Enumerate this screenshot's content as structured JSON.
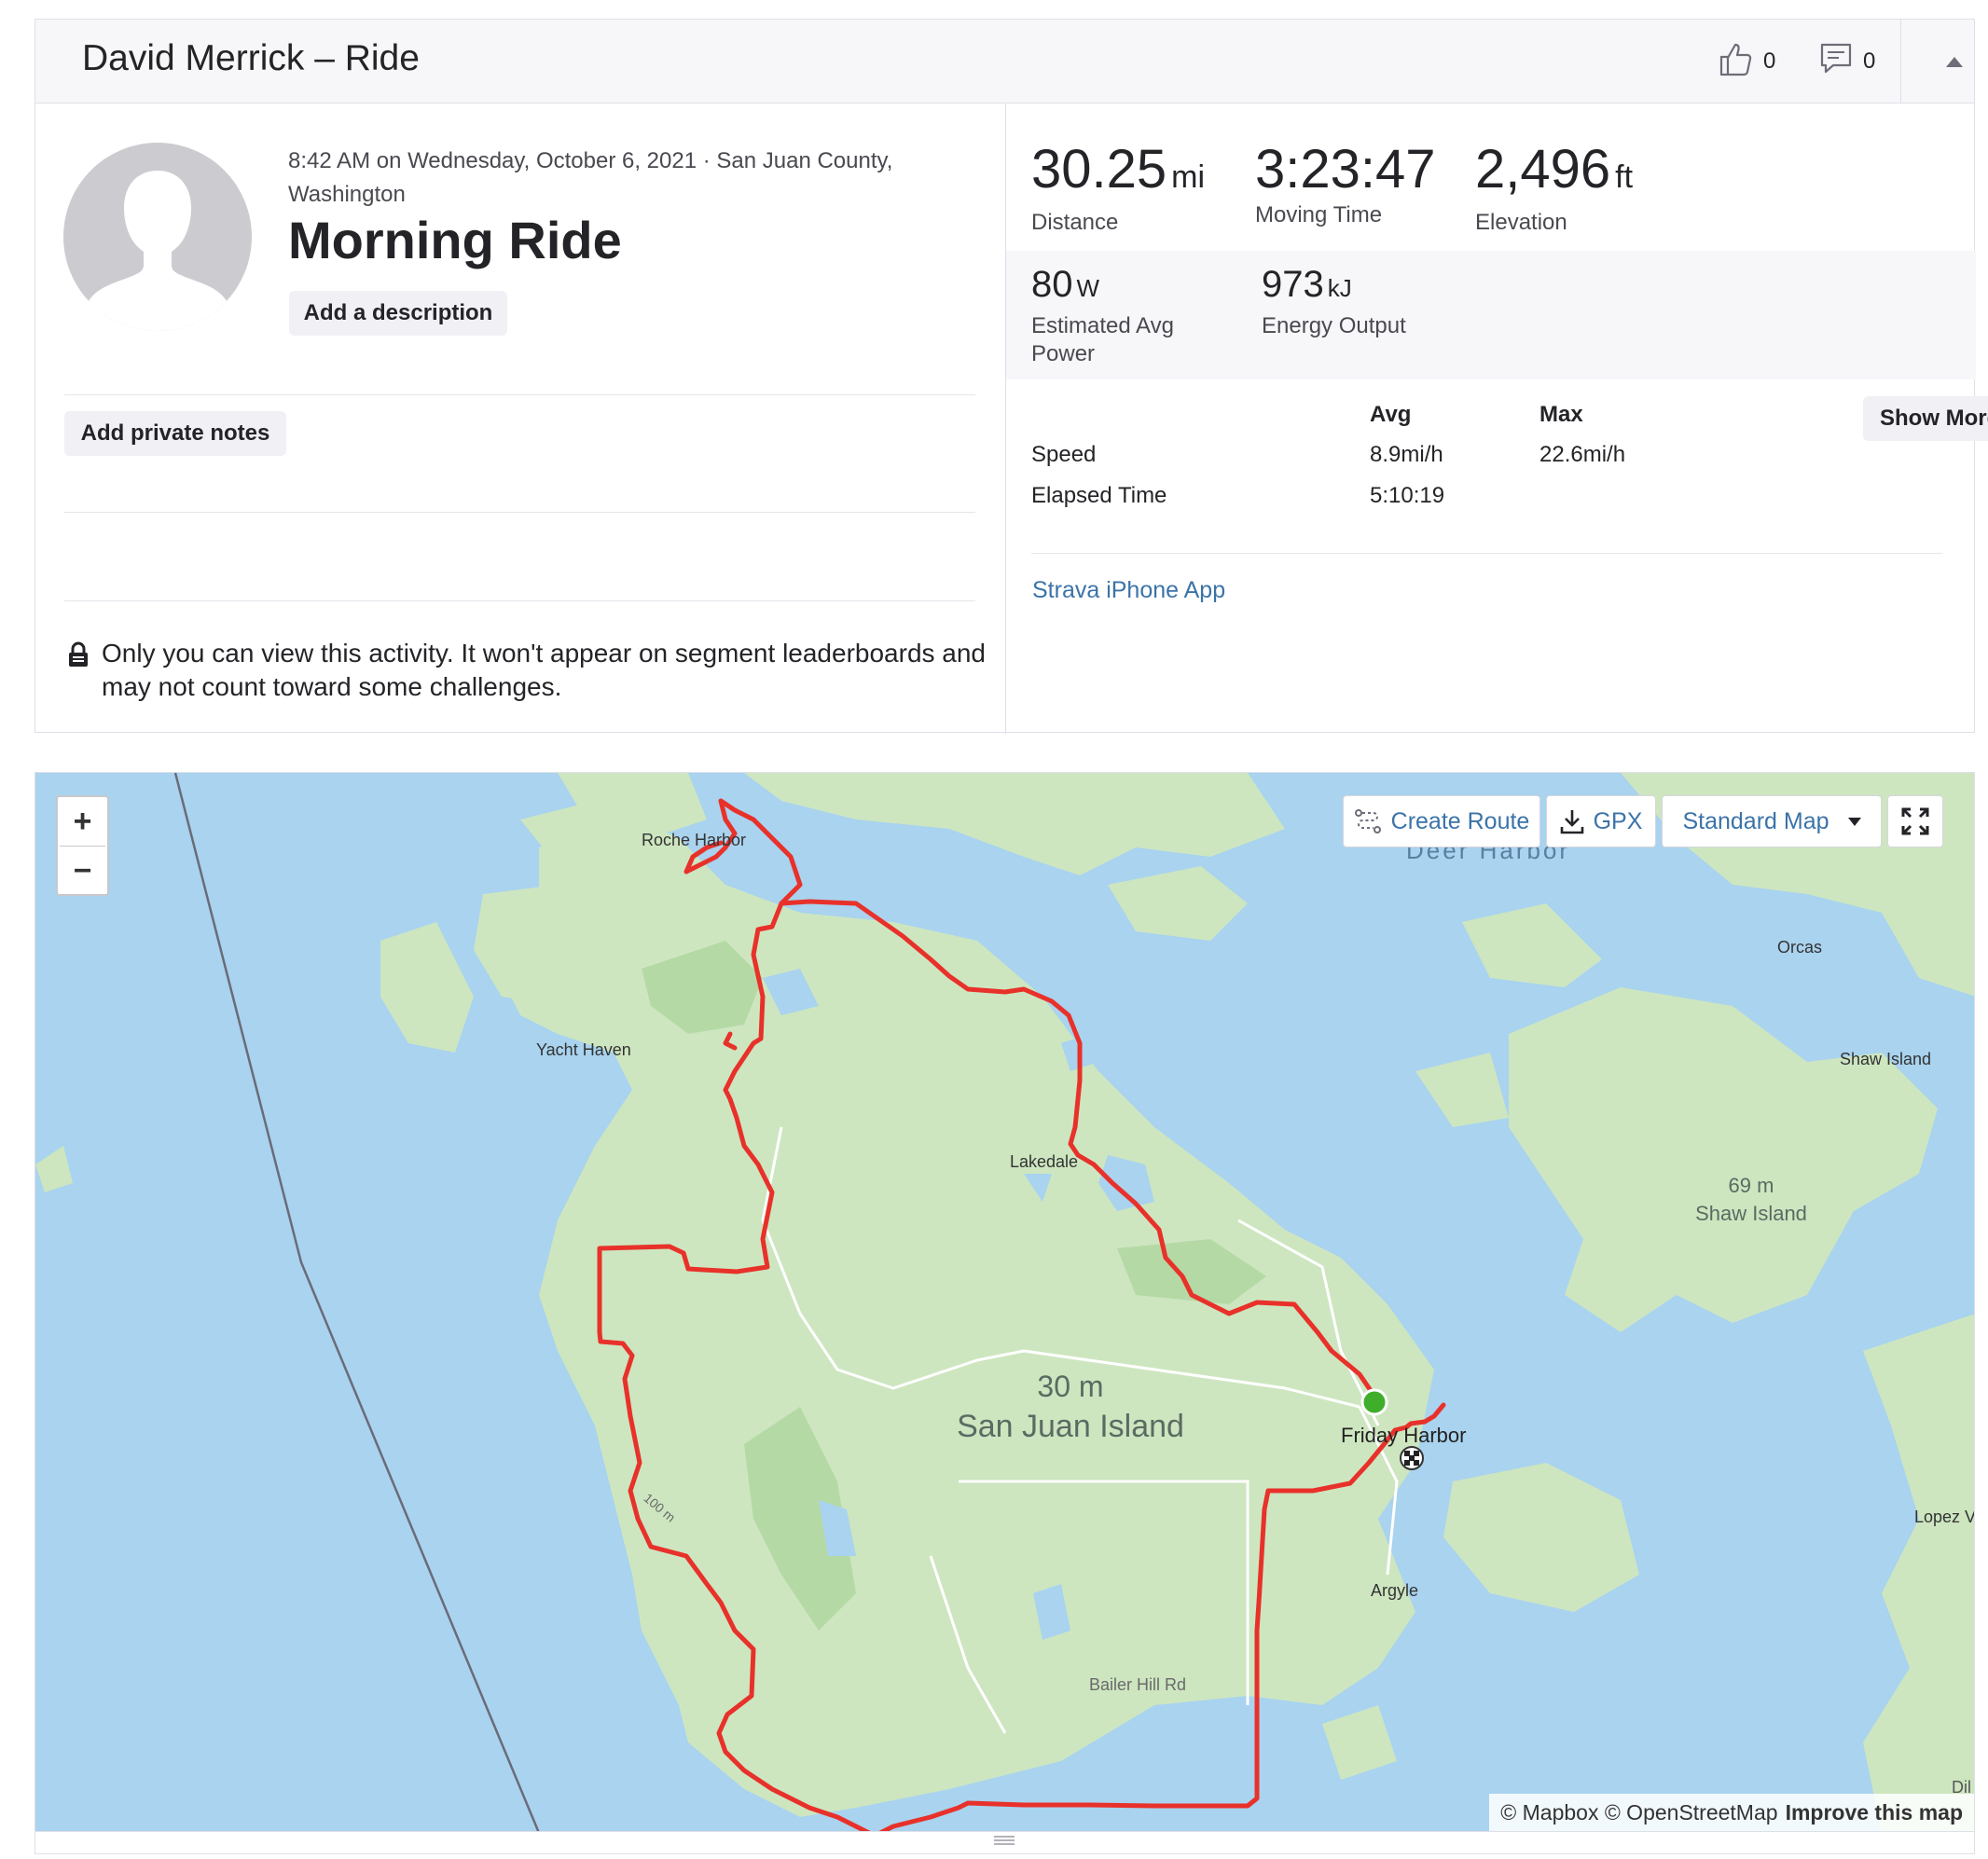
{
  "header": {
    "title": "David Merrick – Ride",
    "kudos_count": "0",
    "comment_count": "0"
  },
  "activity": {
    "datetime_location": "8:42 AM on Wednesday, October 6, 2021 · San Juan County, Washington",
    "name": "Morning Ride",
    "add_description_label": "Add a description",
    "add_notes_label": "Add private notes",
    "privacy_note": "Only you can view this activity. It won't appear on segment leaderboards and may not count toward some challenges."
  },
  "stats": {
    "primary": [
      {
        "value": "30.25",
        "unit": "mi",
        "label": "Distance"
      },
      {
        "value": "3:23:47",
        "unit": "",
        "label": "Moving Time"
      },
      {
        "value": "2,496",
        "unit": "ft",
        "label": "Elevation"
      }
    ],
    "secondary": [
      {
        "value": "80",
        "unit": "W",
        "label": "Estimated Avg Power"
      },
      {
        "value": "973",
        "unit": "kJ",
        "label": "Energy Output"
      }
    ],
    "table": {
      "col_avg": "Avg",
      "col_max": "Max",
      "rows": [
        {
          "label": "Speed",
          "avg": "8.9mi/h",
          "max": "22.6mi/h"
        },
        {
          "label": "Elapsed Time",
          "avg": "5:10:19",
          "max": ""
        }
      ]
    },
    "show_more_label": "Show More",
    "device": "Strava iPhone App"
  },
  "map": {
    "zoom_in": "+",
    "zoom_out": "−",
    "create_route_label": "Create Route",
    "gpx_label": "GPX",
    "map_type_label": "Standard Map",
    "labels": {
      "roche_harbor": "Roche Harbor",
      "deer_harbor": "Deer Harbor",
      "orcas": "Orcas",
      "yacht_haven": "Yacht Haven",
      "shaw_island_small": "Shaw Island",
      "lakedale": "Lakedale",
      "shaw_elev": "69 m",
      "shaw_name": "Shaw Island",
      "sji_elev": "30 m",
      "sji_name": "San Juan Island",
      "friday_harbor": "Friday Harbor",
      "lopez": "Lopez V",
      "argyle": "Argyle",
      "bailer_hill": "Bailer Hill Rd",
      "contour": "100 m",
      "dil": "Dil"
    },
    "attribution_1": "© Mapbox",
    "attribution_2": "© OpenStreetMap",
    "attribution_3": "Improve this map",
    "colors": {
      "water": "#a9d3ef",
      "land": "#cde6c0",
      "route": "#e8312a",
      "start": "#3fae2a"
    }
  }
}
